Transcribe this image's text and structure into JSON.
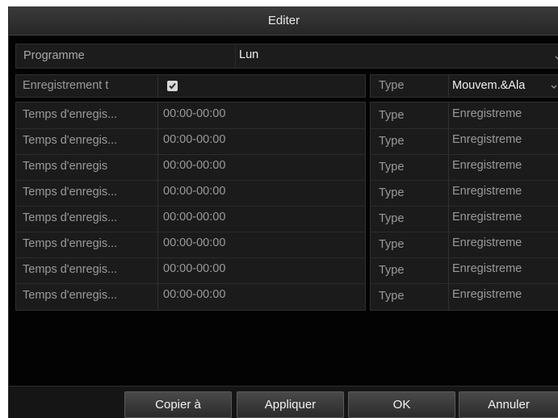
{
  "window": {
    "title": "Editer"
  },
  "schedule": {
    "label": "Programme",
    "value": "Lun"
  },
  "record": {
    "label": "Enregistrement t",
    "checked": true,
    "type_label": "Type",
    "type_value": "Mouvem.&Ala"
  },
  "rows": [
    {
      "label": "Temps d'enregis...",
      "time": "00:00-00:00",
      "type_label": "Type",
      "type_value": "Enregistreme"
    },
    {
      "label": "Temps d'enregis...",
      "time": "00:00-00:00",
      "type_label": "Type",
      "type_value": "Enregistreme"
    },
    {
      "label": "Temps d'enregis",
      "time": "00:00-00:00",
      "type_label": "Type",
      "type_value": "Enregistreme"
    },
    {
      "label": "Temps d'enregis...",
      "time": "00:00-00:00",
      "type_label": "Type",
      "type_value": "Enregistreme"
    },
    {
      "label": "Temps d'enregis...",
      "time": "00:00-00:00",
      "type_label": "Type",
      "type_value": "Enregistreme"
    },
    {
      "label": "Temps d'enregis...",
      "time": "00:00-00:00",
      "type_label": "Type",
      "type_value": "Enregistreme"
    },
    {
      "label": "Temps d'enregis...",
      "time": "00:00-00:00",
      "type_label": "Type",
      "type_value": "Enregistreme"
    },
    {
      "label": "Temps d'enregis...",
      "time": "00:00-00:00",
      "type_label": "Type",
      "type_value": "Enregistreme"
    }
  ],
  "buttons": {
    "copy": "Copier à",
    "apply": "Appliquer",
    "ok": "OK",
    "cancel": "Annuler"
  }
}
